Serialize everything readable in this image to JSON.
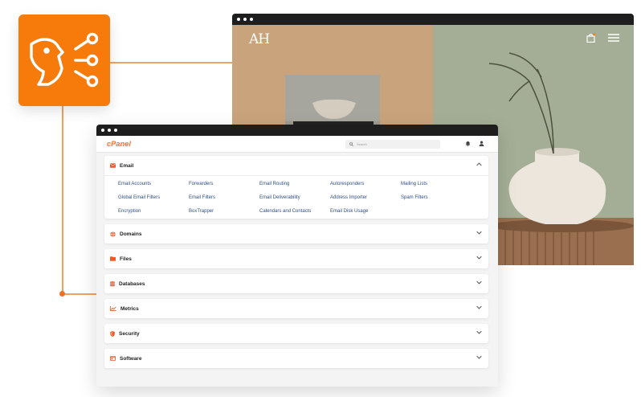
{
  "website": {
    "logo": "AH"
  },
  "cpanel": {
    "logo": "cPanel",
    "search_placeholder": "Search",
    "sections": [
      {
        "title": "Email",
        "expanded": true,
        "links": [
          [
            "Email Accounts",
            "Forwarders",
            "Email Routing",
            "Autoresponders",
            "Mailing Lists"
          ],
          [
            "Global Email Filters",
            "Email Filters",
            "Email Deliverability",
            "Address Importer",
            "Spam Filters"
          ],
          [
            "Encryption",
            "BoxTrapper",
            "Calendars and Contacts",
            "Email Disk Usage"
          ]
        ]
      },
      {
        "title": "Domains",
        "expanded": false
      },
      {
        "title": "Files",
        "expanded": false
      },
      {
        "title": "Databases",
        "expanded": false
      },
      {
        "title": "Metrics",
        "expanded": false
      },
      {
        "title": "Security",
        "expanded": false
      },
      {
        "title": "Software",
        "expanded": false
      }
    ]
  },
  "colors": {
    "accent": "#f77b0b",
    "link": "#2d4f86"
  }
}
